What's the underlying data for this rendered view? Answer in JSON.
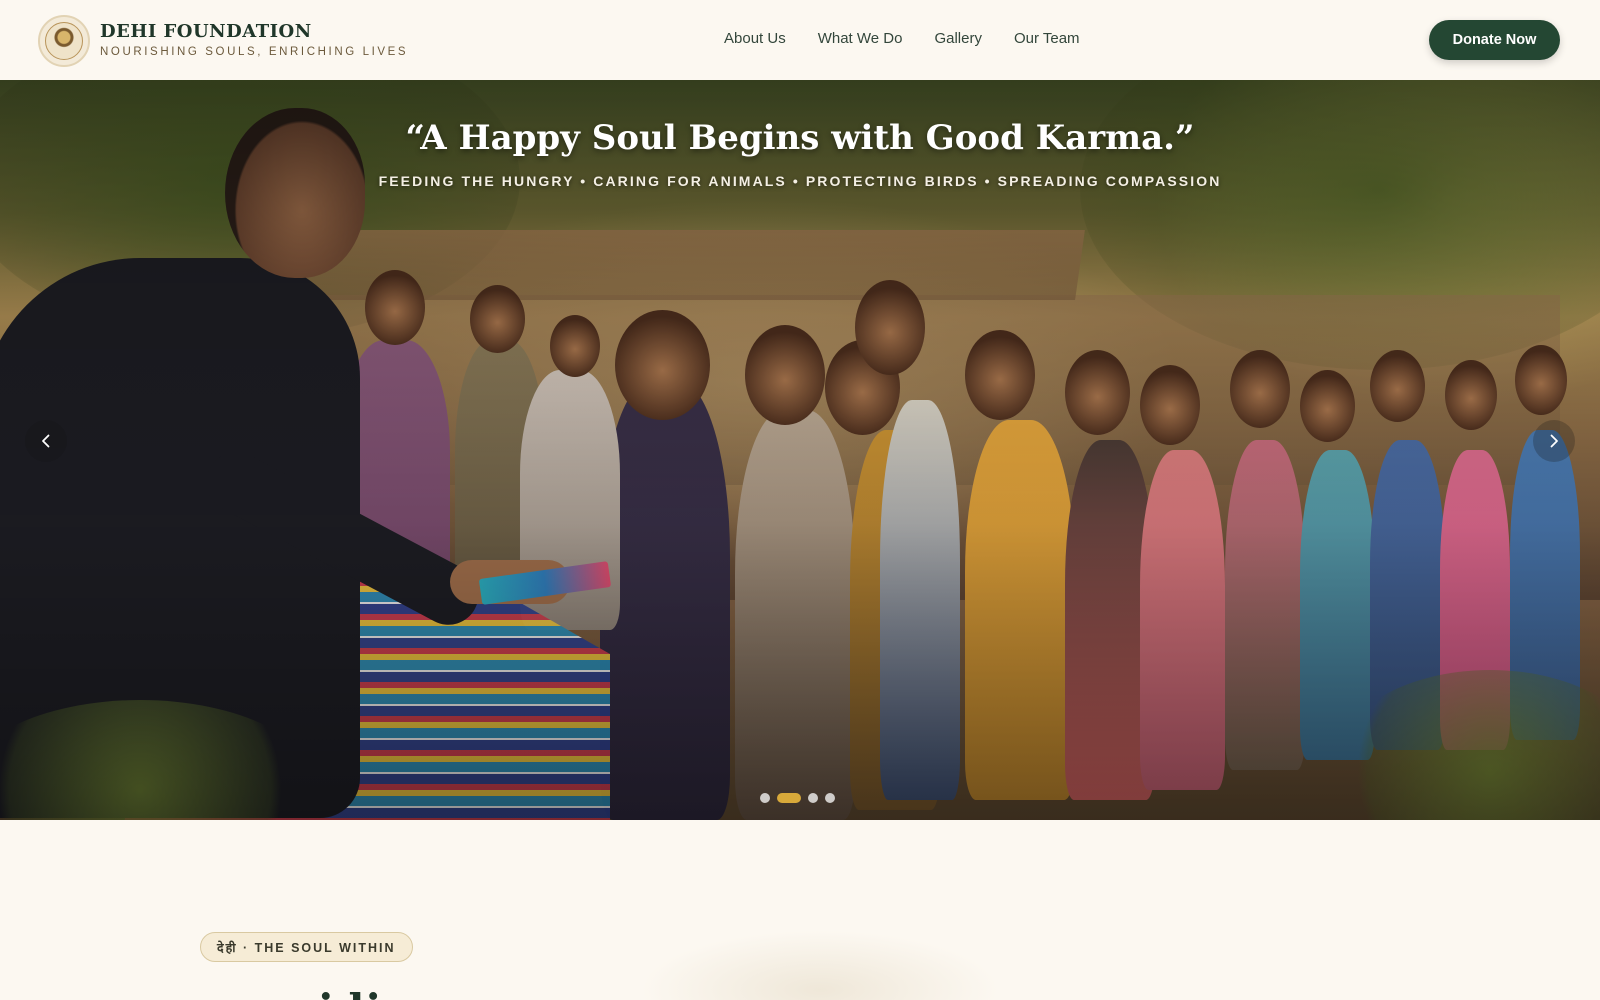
{
  "header": {
    "brand_name": "DEHI FOUNDATION",
    "tagline": "NOURISHING SOULS, ENRICHING LIVES",
    "nav": [
      "About Us",
      "What We Do",
      "Gallery",
      "Our Team"
    ],
    "donate_label": "Donate Now"
  },
  "hero": {
    "quote": "“A Happy Soul Begins with Good Karma.”",
    "subtitle": "FEEDING THE HUNGRY • CARING FOR ANIMALS • PROTECTING BIRDS • SPREADING COMPASSION",
    "slides_total": 4,
    "active_slide": 2,
    "prev_icon": "chevron-left-icon",
    "next_icon": "chevron-right-icon"
  },
  "intro": {
    "pill_label": "देही · THE SOUL WITHIN",
    "heading_peek": "idi..a"
  },
  "colors": {
    "background": "#fcf8f1",
    "brand_green": "#244733",
    "accent_gold": "#d8a93a"
  }
}
